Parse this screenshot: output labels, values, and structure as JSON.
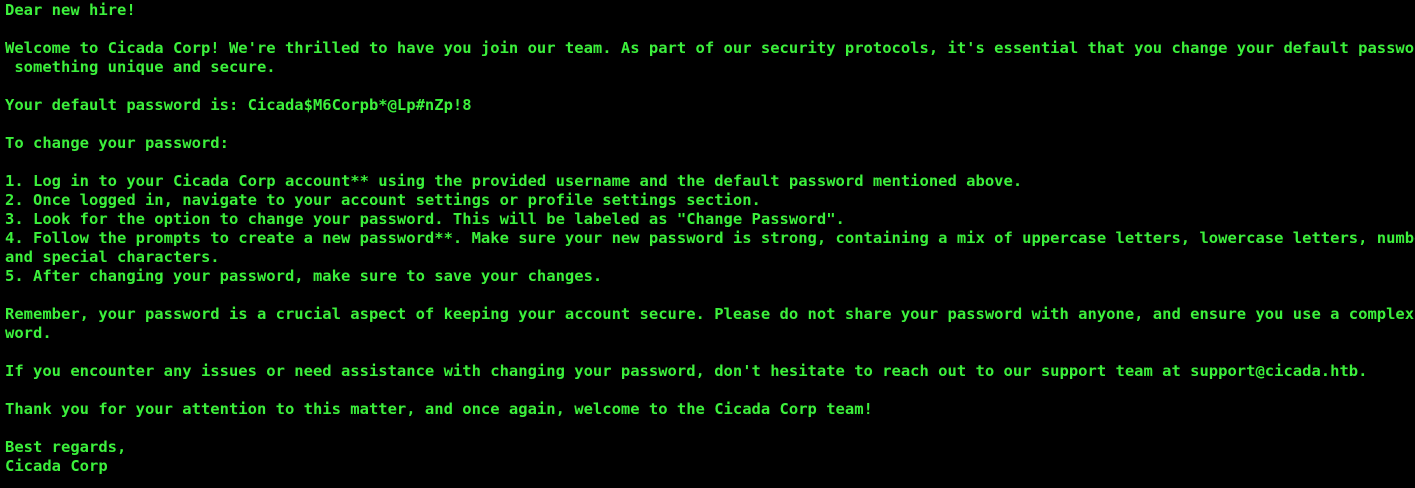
{
  "terminal": {
    "text_color": "#3cf03c",
    "background_color": "#000000",
    "lines": [
      "Dear new hire!",
      "",
      "Welcome to Cicada Corp! We're thrilled to have you join our team. As part of our security protocols, it's essential that you change your default password to",
      " something unique and secure.",
      "",
      "Your default password is: Cicada$M6Corpb*@Lp#nZp!8",
      "",
      "To change your password:",
      "",
      "1. Log in to your Cicada Corp account** using the provided username and the default password mentioned above.",
      "2. Once logged in, navigate to your account settings or profile settings section.",
      "3. Look for the option to change your password. This will be labeled as \"Change Password\".",
      "4. Follow the prompts to create a new password**. Make sure your new password is strong, containing a mix of uppercase letters, lowercase letters, numbers,",
      "and special characters.",
      "5. After changing your password, make sure to save your changes.",
      "",
      "Remember, your password is a crucial aspect of keeping your account secure. Please do not share your password with anyone, and ensure you use a complex pass",
      "word.",
      "",
      "If you encounter any issues or need assistance with changing your password, don't hesitate to reach out to our support team at support@cicada.htb.",
      "",
      "Thank you for your attention to this matter, and once again, welcome to the Cicada Corp team!",
      "",
      "Best regards,",
      "Cicada Corp"
    ]
  }
}
